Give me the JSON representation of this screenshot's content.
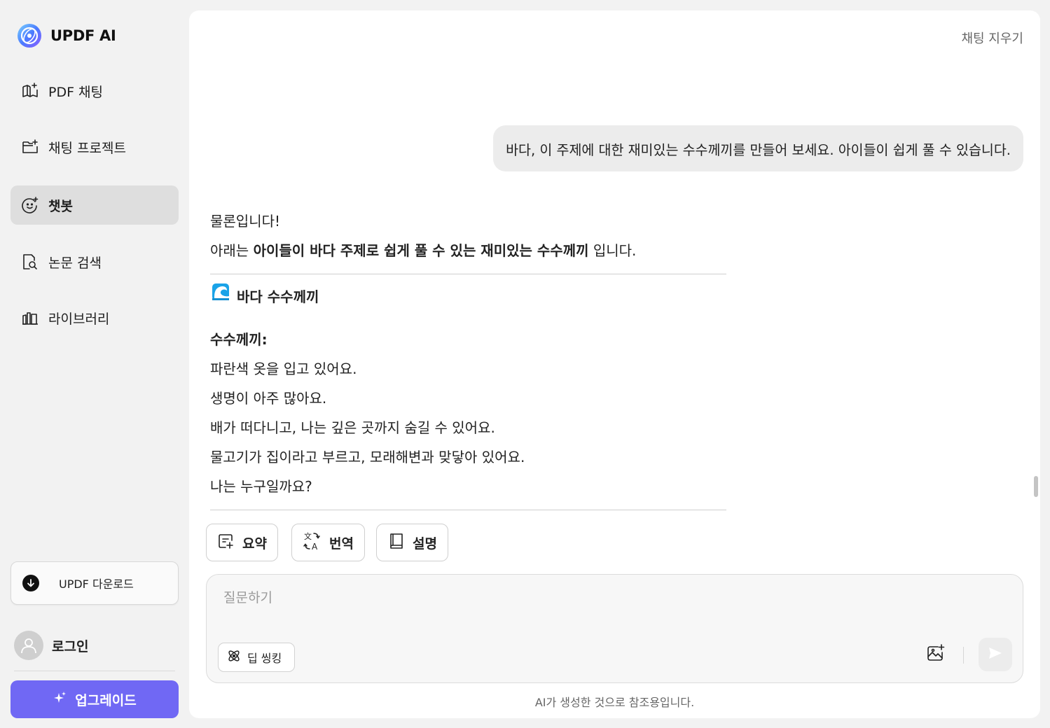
{
  "brand": {
    "name": "UPDF AI",
    "logo_icon": "updf-ai-logo-icon"
  },
  "sidebar": {
    "items": [
      {
        "label": "PDF 채팅",
        "icon": "book-sparkle-icon",
        "active": false
      },
      {
        "label": "채팅 프로젝트",
        "icon": "folder-sparkle-icon",
        "active": false
      },
      {
        "label": "챗봇",
        "icon": "chatbot-face-icon",
        "active": true
      },
      {
        "label": "논문 검색",
        "icon": "document-search-icon",
        "active": false
      },
      {
        "label": "라이브러리",
        "icon": "library-icon",
        "active": false
      }
    ],
    "download_label": "UPDF 다운로드",
    "login_label": "로그인",
    "upgrade_label": "업그레이드",
    "accent_color": "#7068f4"
  },
  "header": {
    "clear_chat_label": "채팅 지우기"
  },
  "conversation": {
    "user_message": "바다, 이 주제에 대한 재미있는 수수께끼를 만들어 보세요. 아이들이 쉽게 풀 수 있습니다.",
    "answer": {
      "greeting": "물론입니다!",
      "intro_prefix": "아래는 ",
      "intro_bold": "아이들이 바다 주제로 쉽게 풀 수 있는 재미있는 수수께끼",
      "intro_suffix": " 입니다.",
      "section_title": "바다 수수께끼",
      "section_icon": "wave-emoji-icon",
      "riddle_label": "수수께끼:",
      "riddle_lines": [
        "파란색 옷을 입고 있어요.",
        "생명이 아주 많아요.",
        "배가 떠다니고, 나는 깊은 곳까지 숨길 수 있어요.",
        "물고기가 집이라고 부르고, 모래해변과 맞닿아 있어요.",
        "나는 누구일까요?"
      ]
    }
  },
  "actions": [
    {
      "label": "요약",
      "icon": "summarize-icon"
    },
    {
      "label": "번역",
      "icon": "translate-icon"
    },
    {
      "label": "설명",
      "icon": "explain-book-icon"
    }
  ],
  "composer": {
    "placeholder": "질문하기",
    "value": "",
    "deep_think_label": "딥 씽킹",
    "image_icon": "image-sparkle-icon",
    "send_icon": "send-icon"
  },
  "footer": {
    "disclaimer": "AI가 생성한 것으로 참조용입니다."
  }
}
